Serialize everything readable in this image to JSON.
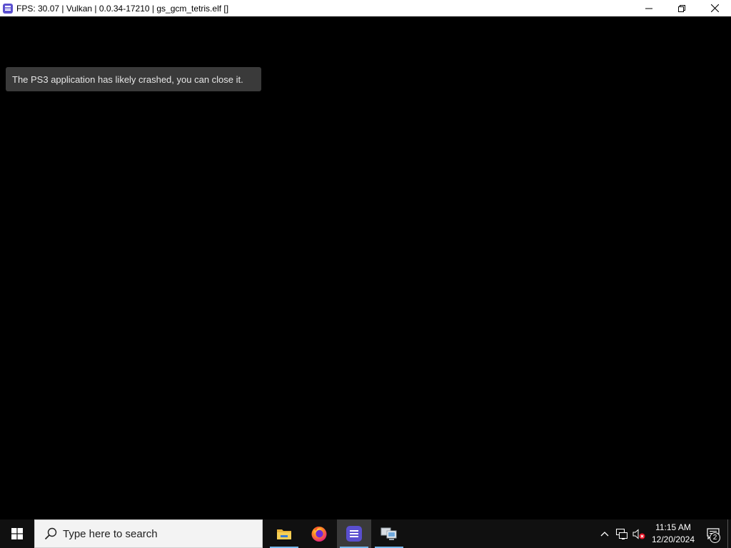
{
  "window": {
    "title": "FPS: 30.07 | Vulkan | 0.0.34-17210 | gs_gcm_tetris.elf []",
    "app_icon": "rpcs3-icon",
    "controls": [
      "minimize-icon",
      "restore-icon",
      "close-icon"
    ]
  },
  "viewport": {
    "toast_message": "The PS3 application has likely crashed, you can close it."
  },
  "taskbar": {
    "start_icon": "windows-logo-icon",
    "search_placeholder": "Type here to search",
    "apps": [
      {
        "name": "File Explorer",
        "icon": "folder-icon",
        "running": true,
        "active": false
      },
      {
        "name": "Firefox",
        "icon": "firefox-icon",
        "running": false,
        "active": false
      },
      {
        "name": "RPCS3",
        "icon": "rpcs3-icon",
        "running": true,
        "active": true
      },
      {
        "name": "Network",
        "icon": "network-computers-icon",
        "running": true,
        "active": false
      }
    ],
    "tray": {
      "icons": [
        "chevron-up-icon",
        "network-icon",
        "volume-muted-icon"
      ],
      "time": "11:15 AM",
      "date": "12/20/2024",
      "notification_count": "2"
    }
  },
  "colors": {
    "accent": "#76b9ed",
    "toast_bg": "#3a3a3a",
    "app_icon": "#5a4fcf"
  }
}
